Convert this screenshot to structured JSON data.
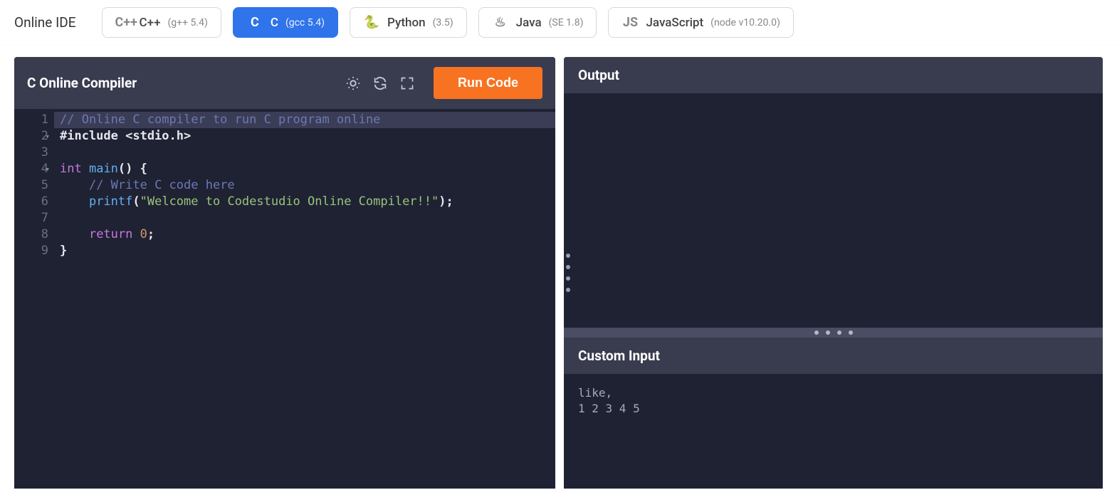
{
  "header": {
    "title": "Online IDE",
    "languages": [
      {
        "icon": "C++",
        "name": "C++",
        "version": "(g++ 5.4)",
        "active": false,
        "id": "cpp"
      },
      {
        "icon": "C",
        "name": "C",
        "version": "(gcc 5.4)",
        "active": true,
        "id": "c"
      },
      {
        "icon": "🐍",
        "name": "Python",
        "version": "(3.5)",
        "active": false,
        "id": "python"
      },
      {
        "icon": "♨",
        "name": "Java",
        "version": "(SE 1.8)",
        "active": false,
        "id": "java"
      },
      {
        "icon": "JS",
        "name": "JavaScript",
        "version": "(node v10.20.0)",
        "active": false,
        "id": "javascript"
      }
    ]
  },
  "editor": {
    "title": "C Online Compiler",
    "run_label": "Run Code",
    "code_lines": [
      {
        "n": 1,
        "fold": false,
        "tokens": [
          {
            "cls": "c-comment",
            "t": "// Online C compiler to run C program online"
          }
        ],
        "hl": true
      },
      {
        "n": 2,
        "fold": true,
        "tokens": [
          {
            "cls": "c-include",
            "t": "#include <stdio.h>"
          }
        ]
      },
      {
        "n": 3,
        "fold": false,
        "tokens": []
      },
      {
        "n": 4,
        "fold": true,
        "tokens": [
          {
            "cls": "c-type",
            "t": "int "
          },
          {
            "cls": "c-func",
            "t": "main"
          },
          {
            "cls": "c-plain",
            "t": "() {"
          }
        ]
      },
      {
        "n": 5,
        "fold": false,
        "tokens": [
          {
            "cls": "c-plain",
            "t": "    "
          },
          {
            "cls": "c-comment",
            "t": "// Write C code here"
          }
        ]
      },
      {
        "n": 6,
        "fold": false,
        "tokens": [
          {
            "cls": "c-plain",
            "t": "    "
          },
          {
            "cls": "c-func",
            "t": "printf"
          },
          {
            "cls": "c-plain",
            "t": "("
          },
          {
            "cls": "c-str",
            "t": "\"Welcome to Codestudio Online Compiler!!\""
          },
          {
            "cls": "c-plain",
            "t": ");"
          }
        ]
      },
      {
        "n": 7,
        "fold": false,
        "tokens": []
      },
      {
        "n": 8,
        "fold": false,
        "tokens": [
          {
            "cls": "c-plain",
            "t": "    "
          },
          {
            "cls": "c-kw",
            "t": "return "
          },
          {
            "cls": "c-num",
            "t": "0"
          },
          {
            "cls": "c-plain",
            "t": ";"
          }
        ]
      },
      {
        "n": 9,
        "fold": false,
        "tokens": [
          {
            "cls": "c-plain",
            "t": "}"
          }
        ]
      }
    ]
  },
  "output": {
    "title": "Output",
    "content": ""
  },
  "custom_input": {
    "title": "Custom Input",
    "value": "like,\n1 2 3 4 5"
  }
}
